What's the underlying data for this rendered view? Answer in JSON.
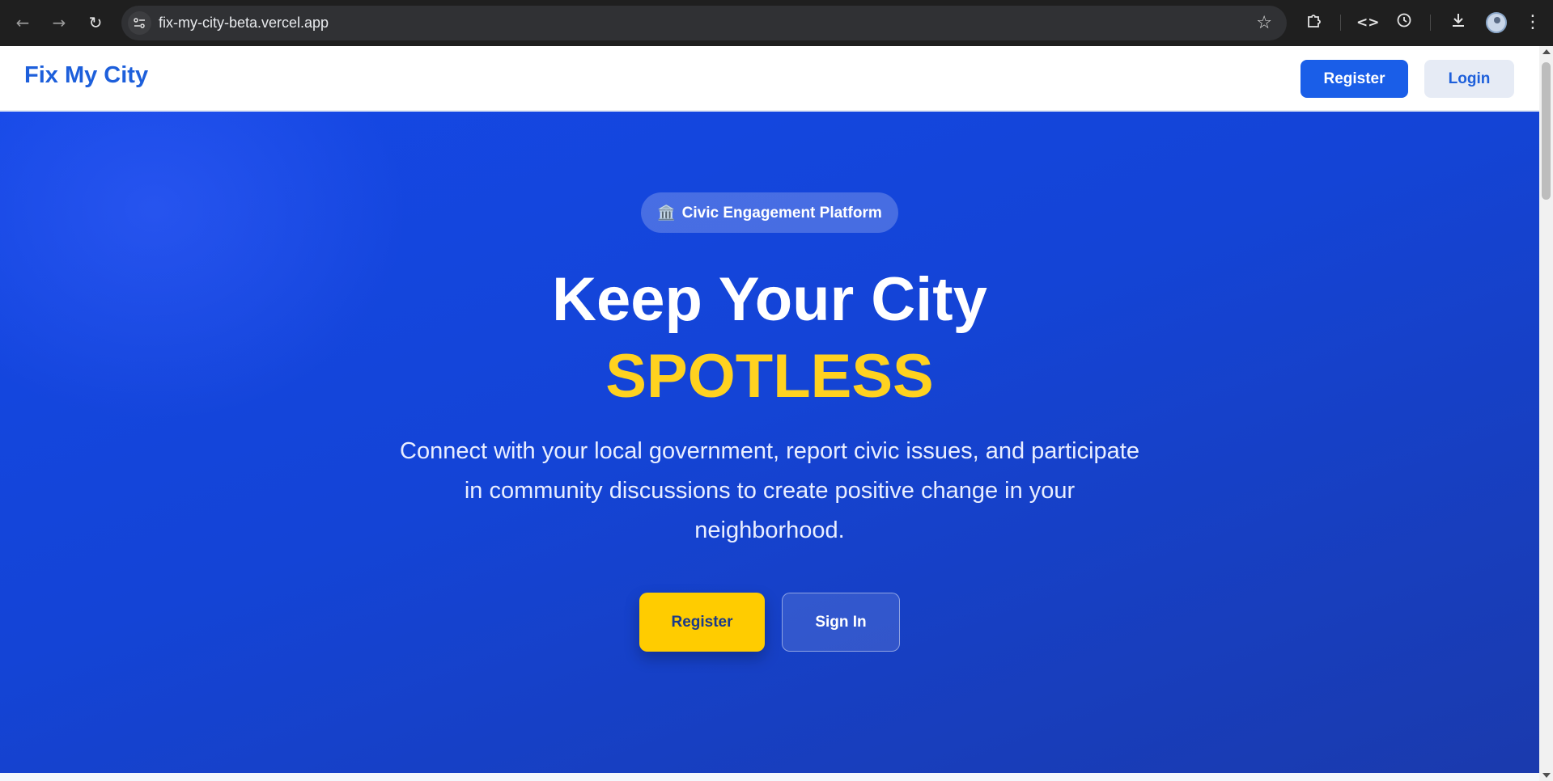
{
  "browser": {
    "url": "fix-my-city-beta.vercel.app",
    "icons": {
      "back": "arrow-left-icon",
      "forward": "arrow-right-icon",
      "reload": "reload-icon",
      "bookmark": "star-icon",
      "extensions": "puzzle-icon",
      "devtools": "code-icon",
      "history": "history-icon",
      "downloads": "download-icon",
      "menu": "kebab-menu-icon"
    }
  },
  "header": {
    "brand": "Fix My City",
    "register_label": "Register",
    "login_label": "Login"
  },
  "hero": {
    "badge_icon": "🏛️",
    "badge_text": "Civic Engagement Platform",
    "headline": "Keep Your City",
    "headline_accent": "SPOTLESS",
    "lead_line1": "Connect with your local government, report civic issues, and participate",
    "lead_line2": "in community discussions to create positive change in your",
    "lead_line3": "neighborhood.",
    "register_label": "Register",
    "signin_label": "Sign In"
  },
  "colors": {
    "brand_blue": "#1d5fdb",
    "primary_button": "#1a5ee8",
    "hero_bg": "#1548e6",
    "accent_yellow": "#ffd21f",
    "cta_yellow": "#ffcc00"
  }
}
